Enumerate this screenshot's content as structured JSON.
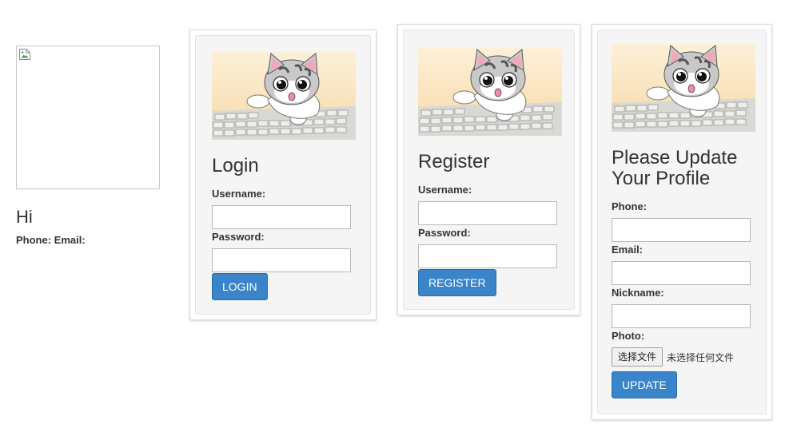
{
  "profile": {
    "greeting": "Hi",
    "contact_line": "Phone: Email:"
  },
  "login": {
    "title": "Login",
    "username_label": "Username:",
    "username_value": "",
    "password_label": "Password:",
    "password_value": "",
    "submit_label": "LOGIN"
  },
  "register": {
    "title": "Register",
    "username_label": "Username:",
    "username_value": "",
    "password_label": "Password:",
    "password_value": "",
    "submit_label": "REGISTER"
  },
  "update": {
    "title_line1": "Please Update",
    "title_line2": "Your Profile",
    "phone_label": "Phone:",
    "phone_value": "",
    "email_label": "Email:",
    "email_value": "",
    "nickname_label": "Nickname:",
    "nickname_value": "",
    "photo_label": "Photo:",
    "file_button_label": "选择文件",
    "file_status": "未选择任何文件",
    "submit_label": "UPDATE"
  },
  "colors": {
    "primary_button": "#3a85c9",
    "card_background": "#f5f5f5"
  },
  "icons": {
    "broken_image": "broken-image-icon",
    "banner": "cat-on-keyboard-illustration"
  }
}
